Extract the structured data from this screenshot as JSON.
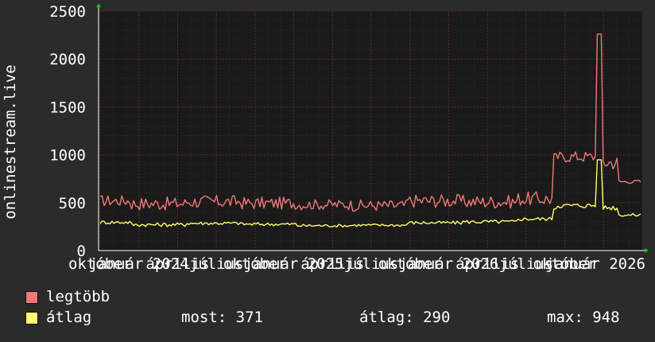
{
  "colors": {
    "background": "#2b2b2b",
    "plot_background": "#1a1a1a",
    "grid_major": "#5a2a2a",
    "grid_minor": "#3a2525",
    "axis_text": "#ffffff",
    "arrow": "#00cc00",
    "legtobb": "#f07878",
    "atlag": "#ffff70"
  },
  "chart_data": {
    "type": "line",
    "ylabel": "onlinestream.live",
    "ylim": [
      0,
      2500
    ],
    "yticks": [
      "0",
      "500",
      "1000",
      "1500",
      "2000",
      "2500"
    ],
    "grid": true,
    "xticks": [
      "október",
      "január 2024",
      "április",
      "július",
      "október",
      "január 2025",
      "április",
      "július",
      "október",
      "január 2026",
      "április",
      "július",
      "október",
      "január 2026"
    ],
    "series": [
      {
        "name": "legtöbb",
        "color": "#f07878",
        "segments": [
          {
            "n": 16,
            "level": 520,
            "noise": 60
          },
          {
            "n": 28,
            "level": 490,
            "noise": 70
          },
          {
            "n": 28,
            "level": 510,
            "noise": 70
          },
          {
            "n": 28,
            "level": 495,
            "noise": 65
          },
          {
            "n": 28,
            "level": 480,
            "noise": 55
          },
          {
            "n": 28,
            "level": 470,
            "noise": 60
          },
          {
            "n": 28,
            "level": 520,
            "noise": 70
          },
          {
            "n": 28,
            "level": 510,
            "noise": 70
          },
          {
            "n": 18,
            "level": 540,
            "noise": 75
          },
          {
            "n": 2,
            "level": 980,
            "noise": 40
          },
          {
            "n": 20,
            "level": 980,
            "noise": 60
          },
          {
            "n": 3,
            "level": 2260,
            "noise": 0
          },
          {
            "n": 8,
            "level": 920,
            "noise": 80
          },
          {
            "n": 12,
            "level": 720,
            "noise": 20
          }
        ]
      },
      {
        "name": "átlag",
        "color": "#ffff70",
        "segments": [
          {
            "n": 16,
            "level": 295,
            "noise": 20
          },
          {
            "n": 28,
            "level": 270,
            "noise": 20
          },
          {
            "n": 28,
            "level": 285,
            "noise": 18
          },
          {
            "n": 28,
            "level": 275,
            "noise": 18
          },
          {
            "n": 28,
            "level": 260,
            "noise": 15
          },
          {
            "n": 28,
            "level": 265,
            "noise": 15
          },
          {
            "n": 28,
            "level": 290,
            "noise": 18
          },
          {
            "n": 28,
            "level": 300,
            "noise": 20
          },
          {
            "n": 18,
            "level": 330,
            "noise": 20
          },
          {
            "n": 2,
            "level": 440,
            "noise": 10
          },
          {
            "n": 20,
            "level": 470,
            "noise": 25
          },
          {
            "n": 3,
            "level": 948,
            "noise": 0
          },
          {
            "n": 8,
            "level": 450,
            "noise": 30
          },
          {
            "n": 12,
            "level": 371,
            "noise": 15
          }
        ]
      }
    ]
  },
  "legend": {
    "items": [
      {
        "name": "legtöbb"
      },
      {
        "name": "átlag"
      }
    ],
    "stats": {
      "now": "most: 371",
      "avg": "átlag: 290",
      "max": "max: 948"
    }
  }
}
